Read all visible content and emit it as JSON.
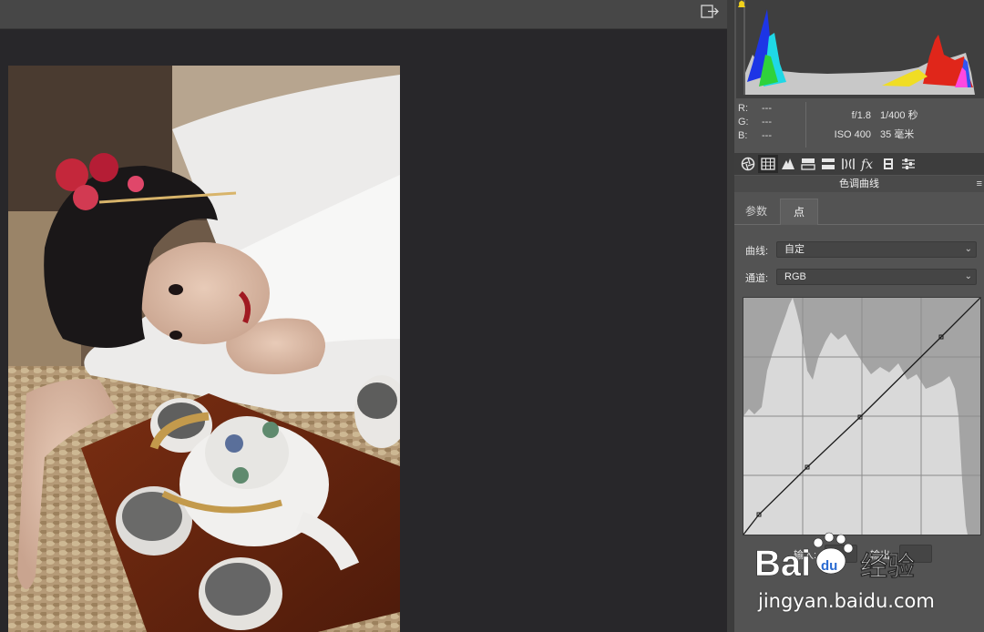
{
  "toolbar": {
    "exit_icon": "exit-fullscreen-icon"
  },
  "readout": {
    "r_label": "R:",
    "r_value": "---",
    "g_label": "G:",
    "g_value": "---",
    "b_label": "B:",
    "b_value": "---"
  },
  "exif": {
    "aperture": "f/1.8",
    "shutter": "1/400 秒",
    "iso": "ISO 400",
    "focal": "35 毫米"
  },
  "tools": [
    "aperture-icon",
    "grid-icon",
    "mountain-icon",
    "split-tone-icon",
    "detail-icon",
    "lens-icon",
    "fx-icon",
    "film-icon",
    "sliders-icon"
  ],
  "panel": {
    "section_title": "色调曲线",
    "tabs": [
      {
        "label": "参数"
      },
      {
        "label": "点"
      }
    ],
    "curve_label": "曲线:",
    "curve_value": "自定",
    "channel_label": "通道:",
    "channel_value": "RGB",
    "input_label": "输入:",
    "output_label": "输出:"
  },
  "colors": {
    "panel": "#535353",
    "canvas": "#28272a",
    "accent_highlight": "#f2d21b"
  },
  "watermark": {
    "site": "jingyan.baidu.com"
  }
}
